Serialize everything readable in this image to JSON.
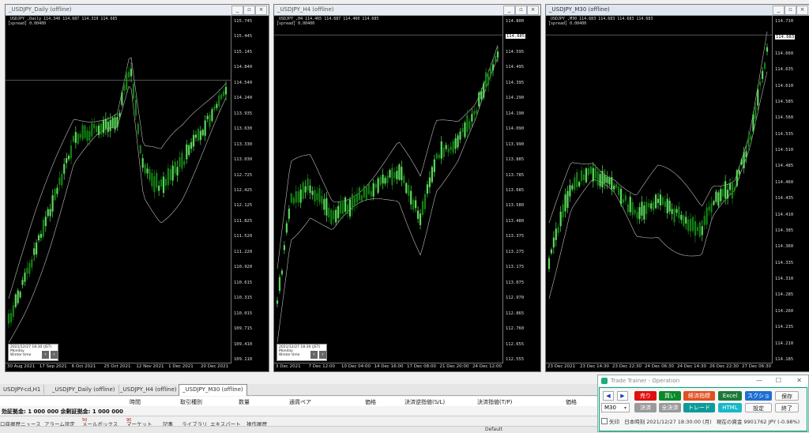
{
  "windows": [
    {
      "title": "_USDJPY_Daily (offline)",
      "header": [
        "_USDJPY_,Daily 114.340 114.687 114.319 114.685",
        "[spread] 0.00400"
      ],
      "price_labels": [
        "115.745",
        "115.445",
        "115.145",
        "114.840",
        "114.540",
        "114.240",
        "113.935",
        "113.630",
        "113.330",
        "113.030",
        "112.725",
        "112.425",
        "112.125",
        "111.825",
        "111.520",
        "111.220",
        "110.920",
        "110.615",
        "110.315",
        "110.015",
        "109.715",
        "109.410",
        "109.110"
      ],
      "current_price": "114.685",
      "time_labels": [
        "30 Aug 2021",
        "17 Sep 2021",
        "6 Oct 2021",
        "25 Oct 2021",
        "12 Nov 2021",
        "1 Dec 2021",
        "20 Dec 2021"
      ],
      "info_box": [
        "2021/12/27 18:30 (JST)",
        "Monday",
        "Winter time"
      ]
    },
    {
      "title": "_USDJPY_H4 (offline)",
      "header": [
        "_USDJPY_,H4 114.465 114.687 114.460 114.685",
        "[spread] 0.00400"
      ],
      "price_labels": [
        "114.800",
        "114.685",
        "114.595",
        "114.495",
        "114.395",
        "114.290",
        "114.190",
        "114.090",
        "113.990",
        "113.885",
        "113.785",
        "113.685",
        "113.580",
        "113.480",
        "113.375",
        "113.275",
        "113.175",
        "113.075",
        "112.970",
        "112.865",
        "112.760",
        "112.655",
        "112.555"
      ],
      "current_price": "114.685",
      "time_labels": [
        "3 Dec 2021",
        "7 Dec 12:00",
        "10 Dec 04:00",
        "14 Dec 16:00",
        "17 Dec 08:00",
        "21 Dec 20:00",
        "24 Dec 12:00"
      ],
      "info_box": [
        "2021/12/27 18:30 (JST)",
        "Monday",
        "Winter time"
      ]
    },
    {
      "title": "_USDJPY_M30 (offline)",
      "header": [
        "_USDJPY_,M30 114.683 114.683 114.683 114.683",
        "[spread] 0.00400"
      ],
      "price_labels": [
        "114.710",
        "114.683",
        "114.660",
        "114.635",
        "114.610",
        "114.585",
        "114.560",
        "114.535",
        "114.510",
        "114.485",
        "114.460",
        "114.435",
        "114.410",
        "114.385",
        "114.360",
        "114.335",
        "114.310",
        "114.285",
        "114.260",
        "114.235",
        "114.210",
        "114.185"
      ],
      "current_price": "114.683",
      "time_labels": [
        "23 Dec 2021",
        "23 Dec 14:30",
        "23 Dec 22:30",
        "24 Dec 06:30",
        "24 Dec 14:30",
        "26 Dec 22:30",
        "27 Dec 06:30"
      ],
      "info_box": []
    }
  ],
  "chart_tabs": [
    "USDJPY-cd,H1",
    "_USDJPY_Daily (offline)",
    "_USDJPY_H4 (offline)",
    "_USDJPY_M30 (offline)"
  ],
  "terminal": {
    "columns": [
      "時間",
      "取引種別",
      "数量",
      "通貨ペア",
      "価格",
      "決済逆指値(S/L)",
      "決済指値(T/P)",
      "価格"
    ],
    "balance": "効証拠金: 1 000 000  余剰証拠金: 1 000 000",
    "tabs": [
      {
        "label": "口座履歴",
        "badge": ""
      },
      {
        "label": "ニュース",
        "badge": ""
      },
      {
        "label": "アラーム設定",
        "badge": ""
      },
      {
        "label": "メールボックス",
        "badge": "50"
      },
      {
        "label": "マーケット",
        "badge": "90"
      },
      {
        "label": "記事",
        "badge": ""
      },
      {
        "label": "ライブラリ",
        "badge": ""
      },
      {
        "label": "エキスパート",
        "badge": ""
      },
      {
        "label": "操作履歴",
        "badge": ""
      }
    ]
  },
  "status_bar": {
    "profile": "Default"
  },
  "trade_trainer": {
    "title": "Trade Trainer - Operation",
    "timeframe": "M30",
    "buttons": {
      "sell": "売り",
      "buy": "買い",
      "econ": "経済指標",
      "excel": "Excel",
      "screenshot": "スクショ",
      "save": "保存",
      "settle": "決済",
      "settle_all": "全決済",
      "trade": "トレード",
      "html": "HTML",
      "settings": "設定",
      "exit": "終了"
    },
    "arrow_label": "矢印",
    "japan_time": "日本時刻 2021/12/27 18:30:00 (月)",
    "balance": "現在の資金 9901762 JPY (-0.98%)"
  },
  "colors": {
    "chart_bg": "#000000",
    "bull": "#5ad85a",
    "bear": "#138013",
    "band": "#bfbfbf"
  }
}
